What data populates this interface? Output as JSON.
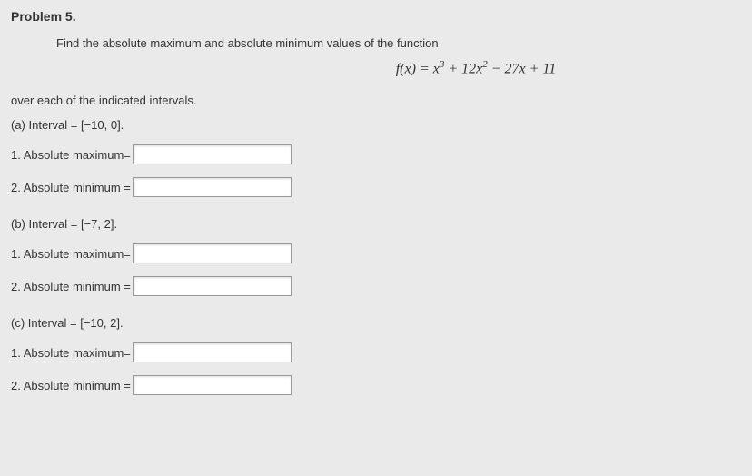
{
  "problem": {
    "title": "Problem 5.",
    "instruction": "Find the absolute maximum and absolute minimum values of the function",
    "equation_html": "<i>f</i>(<i>x</i>) = <i>x</i><sup>3</sup> + 12<i>x</i><sup>2</sup> − 27<i>x</i> + 11",
    "subtext": "over each of the indicated intervals."
  },
  "parts": {
    "a": {
      "interval_label": "(a) Interval = [−10, 0].",
      "q1": {
        "label": "1.  Absolute maximum=",
        "value": ""
      },
      "q2": {
        "label": "2.  Absolute minimum =",
        "value": ""
      }
    },
    "b": {
      "interval_label": "(b) Interval = [−7, 2].",
      "q1": {
        "label": "1.  Absolute maximum=",
        "value": ""
      },
      "q2": {
        "label": "2.  Absolute minimum =",
        "value": ""
      }
    },
    "c": {
      "interval_label": "(c) Interval = [−10, 2].",
      "q1": {
        "label": "1.  Absolute maximum=",
        "value": ""
      },
      "q2": {
        "label": "2.  Absolute minimum =",
        "value": ""
      }
    }
  }
}
